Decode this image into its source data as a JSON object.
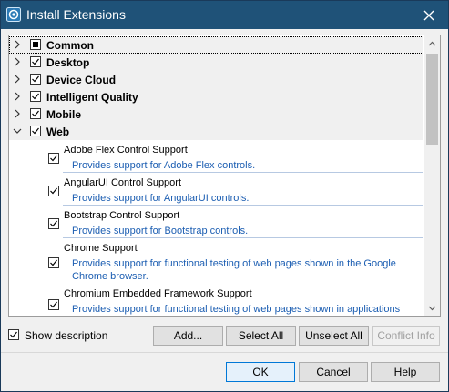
{
  "window": {
    "title": "Install Extensions"
  },
  "categories": [
    {
      "label": "Common",
      "state": "partial",
      "expanded": false
    },
    {
      "label": "Desktop",
      "state": "checked",
      "expanded": false
    },
    {
      "label": "Device Cloud",
      "state": "checked",
      "expanded": false
    },
    {
      "label": "Intelligent Quality",
      "state": "checked",
      "expanded": false
    },
    {
      "label": "Mobile",
      "state": "checked",
      "expanded": false
    },
    {
      "label": "Web",
      "state": "checked",
      "expanded": true
    }
  ],
  "web_items": [
    {
      "name": "Adobe Flex Control Support",
      "description": "Provides support for Adobe Flex controls.",
      "checked": true
    },
    {
      "name": "AngularUI Control Support",
      "description": "Provides support for AngularUI controls.",
      "checked": true
    },
    {
      "name": "Bootstrap Control Support",
      "description": "Provides support for Bootstrap controls.",
      "checked": true
    },
    {
      "name": "Chrome Support",
      "description_line1": "Provides support for functional testing of web pages shown in the Google",
      "description_line2": "Chrome browser.",
      "checked": true
    },
    {
      "name": "Chromium Embedded Framework Support",
      "description": "Provides support for functional testing of web pages shown in applications",
      "checked": true
    }
  ],
  "options": {
    "show_description": "Show description",
    "show_description_checked": true
  },
  "buttons": {
    "add": "Add...",
    "select_all": "Select All",
    "unselect_all": "Unselect All",
    "conflict_info": "Conflict Info",
    "ok": "OK",
    "cancel": "Cancel",
    "help": "Help"
  },
  "colors": {
    "titlebar": "#1f5278",
    "description_link": "#1c5eb2"
  }
}
